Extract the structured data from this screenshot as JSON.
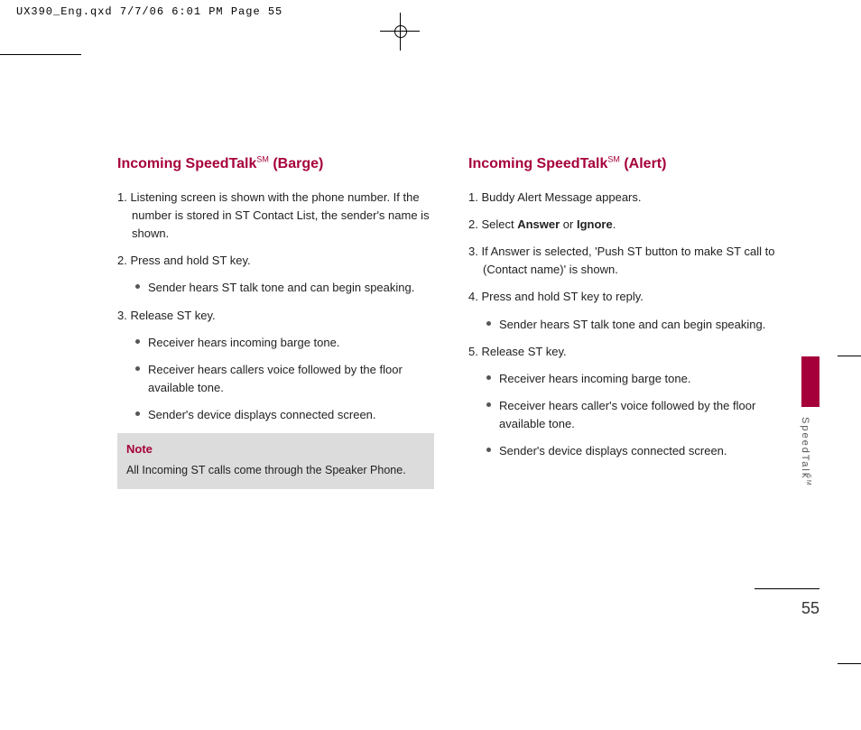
{
  "print_header": "UX390_Eng.qxd  7/7/06  6:01 PM  Page 55",
  "page_number": "55",
  "side_label": "SpeedTalk",
  "side_label_sup": "SM",
  "left": {
    "heading_prefix": "Incoming SpeedTalk",
    "heading_sup": "SM",
    "heading_suffix": " (Barge)",
    "item1": "1. Listening screen is shown with the phone number. If the number is stored in ST Contact List, the sender's name is shown.",
    "item2": "2. Press and hold ST key.",
    "item2_bullets": [
      "Sender hears ST talk tone and can begin speaking."
    ],
    "item3": "3. Release ST key.",
    "item3_bullets": [
      "Receiver hears incoming barge tone.",
      "Receiver hears callers voice followed by the floor available tone.",
      "Sender's device displays connected screen."
    ],
    "note_title": "Note",
    "note_body": "All Incoming ST calls come through the Speaker Phone."
  },
  "right": {
    "heading_prefix": "Incoming SpeedTalk",
    "heading_sup": "SM",
    "heading_suffix": " (Alert)",
    "item1": "1. Buddy Alert Message appears.",
    "item2_pre": "2. Select ",
    "item2_bold1": "Answer",
    "item2_mid": " or ",
    "item2_bold2": "Ignore",
    "item2_post": ".",
    "item3": "3. If Answer is selected, 'Push ST button to make ST call to (Contact name)' is shown.",
    "item4": "4. Press and hold ST key to reply.",
    "item4_bullets": [
      "Sender hears ST talk tone and can begin speaking."
    ],
    "item5": "5. Release ST key.",
    "item5_bullets": [
      "Receiver hears incoming barge tone.",
      "Receiver hears caller's voice followed by the floor available tone.",
      "Sender's device displays connected screen."
    ]
  }
}
